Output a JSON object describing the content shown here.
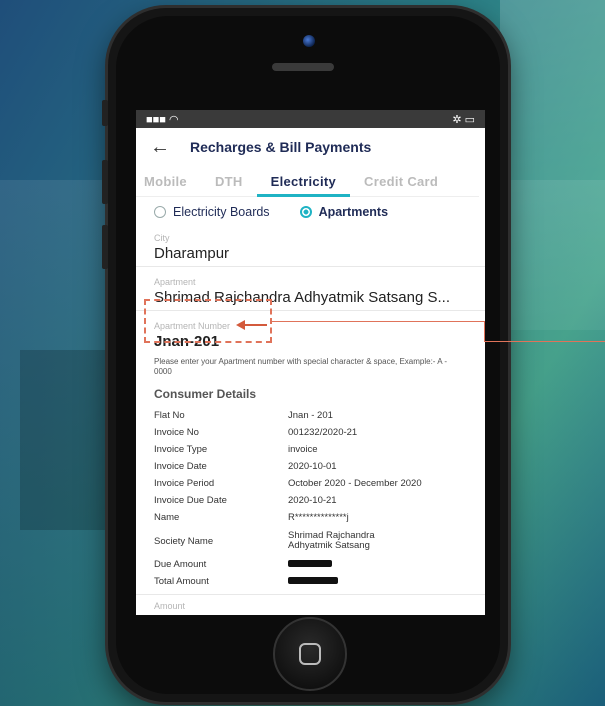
{
  "status_bar": {
    "signal": "■■■ ◠",
    "right": "✲ ▭"
  },
  "header": {
    "back_icon": "←",
    "title": "Recharges & Bill Payments"
  },
  "tabs": [
    {
      "label": "Mobile"
    },
    {
      "label": "DTH"
    },
    {
      "label": "Electricity"
    },
    {
      "label": "Credit Card"
    }
  ],
  "radios": [
    {
      "label": "Electricity Boards",
      "selected": false
    },
    {
      "label": "Apartments",
      "selected": true
    }
  ],
  "city": {
    "label": "City",
    "value": "Dharampur"
  },
  "apartment": {
    "label": "Apartment",
    "value": "Shrimad Rajchandra Adhyatmik Satsang S..."
  },
  "apartment_number": {
    "label": "Apartment Number",
    "value": "Jnan-201",
    "hint": "Please enter your Apartment number with special character & space, Example:- A - 0000"
  },
  "consumer": {
    "heading": "Consumer Details",
    "rows": [
      {
        "key": "Flat No",
        "value": "Jnan - 201"
      },
      {
        "key": "Invoice No",
        "value": "001232/2020-21"
      },
      {
        "key": "Invoice Type",
        "value": "invoice"
      },
      {
        "key": "Invoice Date",
        "value": "2020-10-01"
      },
      {
        "key": "Invoice Period",
        "value": "October 2020 - December 2020"
      },
      {
        "key": "Invoice Due Date",
        "value": "2020-10-21"
      },
      {
        "key": "Name",
        "value": "R**************j"
      },
      {
        "key": "Society Name",
        "value": "Shrimad Rajchandra Adhyatmik Satsang"
      },
      {
        "key": "Due Amount",
        "value": ""
      },
      {
        "key": "Total Amount",
        "value": ""
      }
    ]
  },
  "amount": {
    "label": "Amount",
    "prefix": "₹"
  },
  "colors": {
    "accent": "#1fb3c4",
    "title": "#1f2b56",
    "annotation": "#e0735a"
  }
}
